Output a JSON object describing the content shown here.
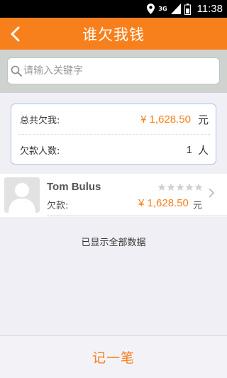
{
  "status_bar": {
    "time": "11:38",
    "network": "3G",
    "icons": [
      "location-icon",
      "signal-icon",
      "battery-icon"
    ]
  },
  "header": {
    "title": "谁欠我钱",
    "back_icon": "chevron-left-icon"
  },
  "search": {
    "placeholder": "请输入关键字",
    "icon": "search-icon"
  },
  "summary": {
    "total_label": "总共欠我:",
    "total_amount": "¥ 1,628.50",
    "total_unit": "元",
    "count_label": "欠款人数:",
    "count_value": "1",
    "count_unit": "人"
  },
  "debtors": [
    {
      "name": "Tom Bulus",
      "owe_label": "欠款:",
      "amount": "¥ 1,628.50",
      "unit": "元",
      "rating": 0,
      "rating_max": 5
    }
  ],
  "list_status": "已显示全部数据",
  "footer": {
    "record_label": "记一笔"
  },
  "colors": {
    "accent": "#f7801d",
    "background": "#f0eff5",
    "card_border": "#a9c4e8"
  }
}
